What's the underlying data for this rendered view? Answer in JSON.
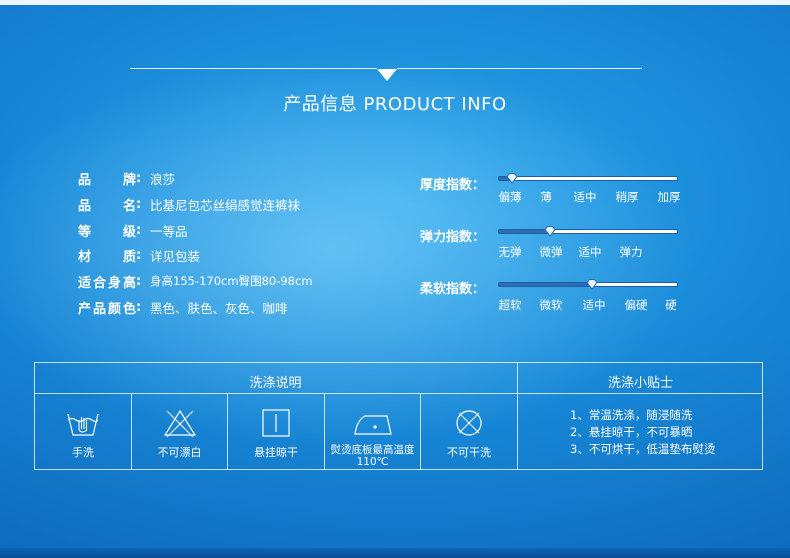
{
  "header": {
    "title": "产品信息 PRODUCT INFO"
  },
  "specs": [
    {
      "label": "品牌",
      "value": "浪莎"
    },
    {
      "label": "品名",
      "value": "比基尼包芯丝绢感觉连裤袜"
    },
    {
      "label": "等级",
      "value": "一等品"
    },
    {
      "label": "材质",
      "value": "详见包装"
    },
    {
      "label": "适合身高",
      "value": "身高155-170cm臀围80-98cm"
    },
    {
      "label": "产品颜色",
      "value": "黑色、肤色、灰色、咖啡"
    }
  ],
  "indices": [
    {
      "label": "厚度指数：",
      "scale": [
        "偏薄",
        "薄",
        "适中",
        "稍厚",
        "加厚"
      ],
      "level_fraction": 0.08
    },
    {
      "label": "弹力指数：",
      "scale": [
        "无弹",
        "微弹",
        "适中",
        "弹力"
      ],
      "level_fraction": 0.29
    },
    {
      "label": "柔软指数：",
      "scale": [
        "超软",
        "微软",
        "适中",
        "偏硬",
        "硬"
      ],
      "level_fraction": 0.52
    }
  ],
  "table": {
    "wash_header": "洗涤说明",
    "tips_header": "洗涤小贴士",
    "wash_items": [
      {
        "label": "手洗",
        "icon": "hand-wash-icon"
      },
      {
        "label": "不可漂白",
        "icon": "no-bleach-icon"
      },
      {
        "label": "悬挂晾干",
        "icon": "hang-dry-icon"
      },
      {
        "label": "熨烫底板最高温度110℃",
        "icon": "iron-low-icon"
      },
      {
        "label": "不可干洗",
        "icon": "no-dry-clean-icon"
      }
    ],
    "tips": [
      "1、常温洗涤，随浸随洗",
      "2、悬挂晾干，不可暴晒",
      "3、不可烘干，低温垫布熨烫"
    ]
  },
  "colors": {
    "track_fill": "#2d6db0",
    "background_mid": "#1786d6",
    "text": "#ffffff"
  }
}
